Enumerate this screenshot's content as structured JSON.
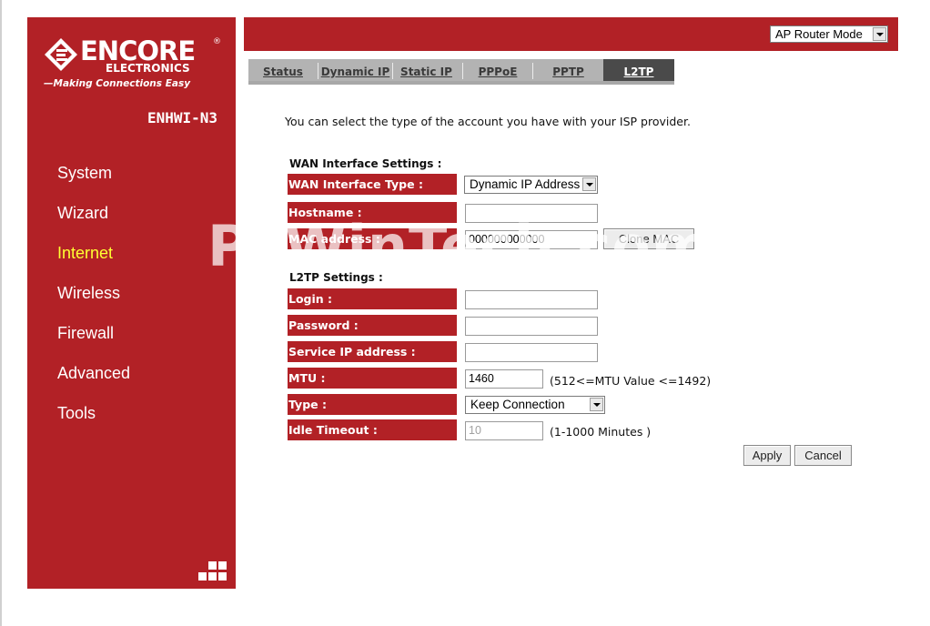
{
  "brand": {
    "logo_word": "ENCORE",
    "logo_sub": "ELECTRONICS",
    "logo_registered": "®",
    "tagline": "—Making Connections Easy",
    "model": "ENHWI-N3"
  },
  "sidebar": {
    "items": [
      {
        "label": "System"
      },
      {
        "label": "Wizard"
      },
      {
        "label": "Internet"
      },
      {
        "label": "Wireless"
      },
      {
        "label": "Firewall"
      },
      {
        "label": "Advanced"
      },
      {
        "label": "Tools"
      }
    ],
    "active": "Internet"
  },
  "header": {
    "mode_select": "AP Router Mode"
  },
  "tabs": [
    {
      "label": "Status"
    },
    {
      "label": "Dynamic IP"
    },
    {
      "label": "Static IP"
    },
    {
      "label": "PPPoE"
    },
    {
      "label": "PPTP"
    },
    {
      "label": "L2TP"
    }
  ],
  "content": {
    "intro": "You can select the type of the account you have with your ISP provider.",
    "wan_section_title": "WAN Interface Settings :",
    "wan": {
      "type_label": "WAN Interface Type :",
      "type_value": "Dynamic IP Address",
      "hostname_label": "Hostname :",
      "hostname_value": "",
      "mac_label": "MAC address :",
      "mac_value": "000000000000",
      "clone_mac_button": "Clone MAC"
    },
    "l2tp_section_title": "L2TP Settings :",
    "l2tp": {
      "login_label": "Login :",
      "login_value": "",
      "password_label": "Password :",
      "password_value": "",
      "service_ip_label": "Service IP address :",
      "service_ip_value": "",
      "mtu_label": "MTU :",
      "mtu_value": "1460",
      "mtu_hint": "(512<=MTU Value <=1492)",
      "type_label": "Type :",
      "type_value": "Keep Connection",
      "idle_label": "Idle Timeout :",
      "idle_value": "10",
      "idle_hint": "(1-1000 Minutes )"
    },
    "apply_button": "Apply",
    "cancel_button": "Cancel"
  },
  "watermark": "PcWinTech.com",
  "colors": {
    "brand_red": "#b22126",
    "active_nav": "#ffff33",
    "tab_bg": "#b3b3b3",
    "tab_active": "#4a4a4a"
  }
}
